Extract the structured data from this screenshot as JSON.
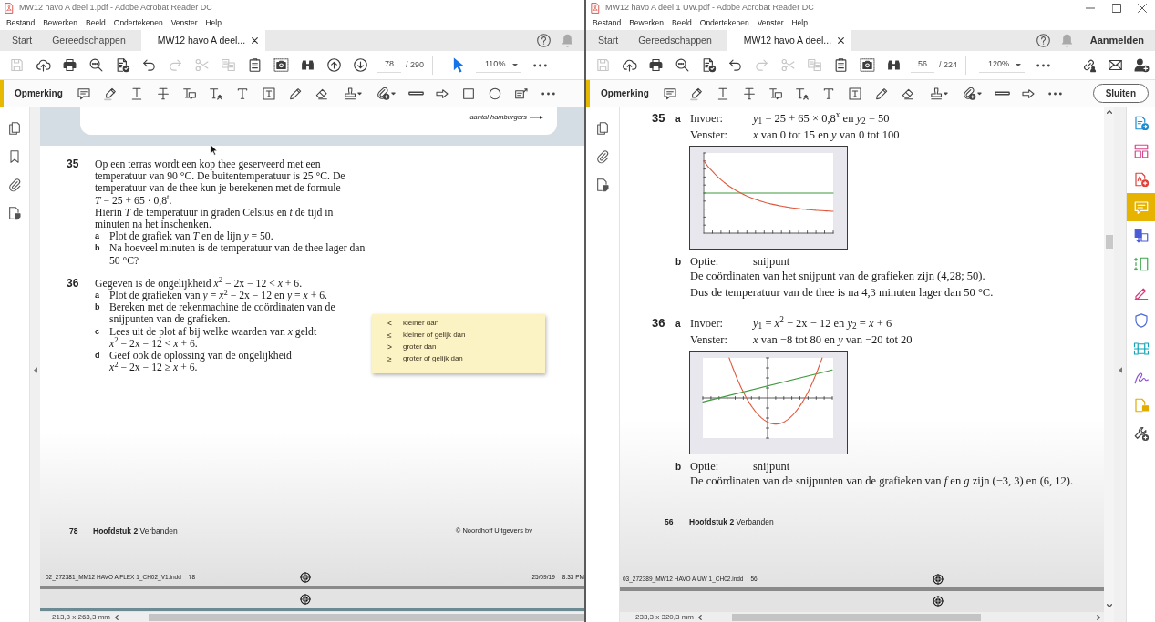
{
  "windows": [
    {
      "title": "MW12 havo A deel 1.pdf - Adobe Acrobat Reader DC",
      "menu": [
        "Bestand",
        "Bewerken",
        "Beeld",
        "Ondertekenen",
        "Venster",
        "Help"
      ],
      "tabs": [
        {
          "label": "Start",
          "selected": false
        },
        {
          "label": "Gereedschappen",
          "selected": false
        },
        {
          "label": "MW12 havo A deel...",
          "selected": true
        }
      ],
      "toolbar": [
        {
          "kind": "save",
          "disabled": true
        },
        {
          "kind": "upload",
          "disabled": false
        },
        {
          "kind": "print",
          "disabled": false
        },
        {
          "kind": "zoomsearch",
          "disabled": false
        },
        {
          "kind": "filecheck",
          "disabled": false
        },
        {
          "kind": "undo",
          "disabled": false
        },
        {
          "kind": "redo",
          "disabled": true
        },
        {
          "kind": "cut",
          "disabled": true
        },
        {
          "kind": "compare",
          "disabled": true
        },
        {
          "kind": "clipboard",
          "disabled": false
        },
        {
          "kind": "snapshot",
          "disabled": false
        },
        {
          "kind": "find",
          "disabled": false
        },
        {
          "kind": "pageup",
          "disabled": false
        },
        {
          "kind": "pagedown",
          "disabled": false
        }
      ],
      "page_field": "78",
      "page_total": "/ 290",
      "select_tool": {
        "selected": true
      },
      "zoom": "110%",
      "comment_toolbar": {
        "label": "Opmerking",
        "tools": [
          {
            "kind": "comment"
          },
          {
            "kind": "highlight"
          },
          {
            "kind": "underline"
          },
          {
            "kind": "strikethrough"
          },
          {
            "kind": "replace"
          },
          {
            "kind": "insert"
          },
          {
            "kind": "text"
          },
          {
            "kind": "textbox"
          },
          {
            "kind": "pencil"
          },
          {
            "kind": "eraser"
          },
          {
            "kind": "stamp"
          },
          {
            "kind": "attach"
          },
          {
            "kind": "line"
          },
          {
            "kind": "arrow"
          },
          {
            "kind": "rectangle"
          },
          {
            "kind": "oval"
          },
          {
            "kind": "callout"
          },
          {
            "kind": "more"
          }
        ]
      },
      "nav_panel": [
        {
          "kind": "pages"
        },
        {
          "kind": "bookmark"
        },
        {
          "kind": "attachment"
        },
        {
          "kind": "tags"
        }
      ],
      "document": {
        "kind": "exercises",
        "mouse_pointer": true,
        "figure_caption": "aantal hamburgers",
        "exercises": [
          {
            "number": "35",
            "paragraphs": [
              "Op een terras wordt een kop thee geserveerd met een temperatuur van 90 °C. De buitentemperatuur is 25 °C. De temperatuur van de thee kun je berekenen met de formule",
              "*T* = 25 + 65 · 0,8$^{t}$.",
              "Hierin *T* de temperatuur in graden Celsius en *t* de tijd in minuten na het inschenken."
            ],
            "parts": [
              {
                "label": "a",
                "text": "Plot de grafiek van *T* en de lijn *y* = 50."
              },
              {
                "label": "b",
                "text": "Na hoeveel minuten is de temperatuur van de thee lager dan 50 °C?"
              }
            ]
          },
          {
            "number": "36",
            "paragraphs": [
              "Gegeven is de ongelijkheid *x*$^{2}$ − 2x − 12 < *x* + 6."
            ],
            "parts": [
              {
                "label": "a",
                "text": "Plot de grafieken van *y* = *x*$^{2}$ − 2x − 12 en *y* = *x* + 6."
              },
              {
                "label": "b",
                "text": "Bereken met de rekenmachine de coördinaten van de snijpunten van de grafieken."
              },
              {
                "label": "c",
                "text": "Lees uit de plot af bij welke waarden van *x* geldt",
                "formula": "*x*$^{2}$ − 2x − 12 < *x* + 6."
              },
              {
                "label": "d",
                "text": "Geef ook de oplossing van de ongelijkheid",
                "formula": "*x*$^{2}$ − 2x − 12 ≥ *x* + 6."
              }
            ]
          }
        ],
        "note": [
          {
            "symbol": "<",
            "text": "kleiner dan"
          },
          {
            "symbol": "≤",
            "text": "kleiner of gelijk dan"
          },
          {
            "symbol": ">",
            "text": "groter dan"
          },
          {
            "symbol": "≥",
            "text": "groter of gelijk dan"
          }
        ],
        "footer": {
          "page": "78",
          "chapter": "**Hoofdstuk 2** Verbanden",
          "copyright": "© Noordhoff Uitgevers bv"
        },
        "slug": {
          "file": "02_272381_MM12 HAVO A FLEX 1_CH02_V1.indd",
          "page": "78",
          "date": "25/09/19",
          "time": "8:33 PM"
        }
      },
      "status": "213,3 x 263,3 mm"
    },
    {
      "title": "MW12 havo A deel 1 UW.pdf - Adobe Acrobat Reader DC",
      "window_controls": true,
      "menu": [
        "Bestand",
        "Bewerken",
        "Beeld",
        "Ondertekenen",
        "Venster",
        "Help"
      ],
      "tabs": [
        {
          "label": "Start",
          "selected": false
        },
        {
          "label": "Gereedschappen",
          "selected": false
        },
        {
          "label": "MW12 havo A deel...",
          "selected": true
        }
      ],
      "sign_in": "Aanmelden",
      "toolbar": [
        {
          "kind": "save",
          "disabled": true
        },
        {
          "kind": "upload",
          "disabled": false
        },
        {
          "kind": "print",
          "disabled": false
        },
        {
          "kind": "zoomsearch",
          "disabled": false
        },
        {
          "kind": "filecheck",
          "disabled": false
        },
        {
          "kind": "undo",
          "disabled": false
        },
        {
          "kind": "redo",
          "disabled": true
        },
        {
          "kind": "cut",
          "disabled": true
        },
        {
          "kind": "compare",
          "disabled": true
        },
        {
          "kind": "clipboard",
          "disabled": false
        },
        {
          "kind": "snapshot",
          "disabled": false
        },
        {
          "kind": "find",
          "disabled": false
        }
      ],
      "page_field": "56",
      "page_total": "/ 224",
      "zoom": "120%",
      "share_tools": [
        {
          "kind": "link"
        },
        {
          "kind": "mail"
        },
        {
          "kind": "adduser"
        }
      ],
      "comment_toolbar": {
        "label": "Opmerking",
        "tools": [
          {
            "kind": "comment"
          },
          {
            "kind": "highlight"
          },
          {
            "kind": "underline"
          },
          {
            "kind": "strikethrough"
          },
          {
            "kind": "replace"
          },
          {
            "kind": "insert"
          },
          {
            "kind": "text"
          },
          {
            "kind": "textbox"
          },
          {
            "kind": "pencil"
          },
          {
            "kind": "eraser"
          },
          {
            "kind": "stamp"
          },
          {
            "kind": "attach"
          },
          {
            "kind": "line"
          },
          {
            "kind": "arrow"
          },
          {
            "kind": "more"
          }
        ],
        "close_button": "Sluiten"
      },
      "nav_panel": [
        {
          "kind": "pages"
        },
        {
          "kind": "attachment"
        },
        {
          "kind": "tags"
        }
      ],
      "tools_panel": [
        {
          "kind": "export",
          "selected": false
        },
        {
          "kind": "organize",
          "selected": false
        },
        {
          "kind": "create",
          "selected": false
        },
        {
          "kind": "comment",
          "selected": true
        },
        {
          "kind": "combine",
          "selected": false
        },
        {
          "kind": "edit",
          "selected": false
        },
        {
          "kind": "fill",
          "selected": false
        },
        {
          "kind": "protect",
          "selected": false
        },
        {
          "kind": "scan",
          "selected": false
        },
        {
          "kind": "sign",
          "selected": false
        },
        {
          "kind": "send",
          "selected": false
        },
        {
          "kind": "tools",
          "selected": false
        }
      ],
      "document": {
        "kind": "answers",
        "answers": [
          {
            "number": "35",
            "parts": [
              {
                "label": "a",
                "rows": [
                  {
                    "key": "Invoer:",
                    "value": "*y*$_{1}$ = 25 + 65 × 0,8$^{x}$ en *y*$_{2}$ = 50"
                  },
                  {
                    "key": "Venster:",
                    "value": "*x* van 0 tot 15 en *y* van 0 tot 100"
                  }
                ],
                "graph": {
                  "kind": "exponential"
                }
              },
              {
                "label": "b",
                "rows": [
                  {
                    "key": "Optie:",
                    "value": "snijpunt"
                  }
                ],
                "lines": [
                  "De coördinaten van het snijpunt van de grafieken zijn (4,28; 50).",
                  "Dus de temperatuur van de thee is na 4,3 minuten lager dan 50 °C."
                ]
              }
            ]
          },
          {
            "number": "36",
            "parts": [
              {
                "label": "a",
                "rows": [
                  {
                    "key": "Invoer:",
                    "value": "*y*$_{1}$ = *x*$^{2}$ − 2x − 12 en *y*$_{2}$ = *x* + 6"
                  },
                  {
                    "key": "Venster:",
                    "value": "*x* van −8 tot 80 en *y* van −20 tot 20"
                  }
                ],
                "graph": {
                  "kind": "parabola"
                }
              },
              {
                "label": "b",
                "rows": [
                  {
                    "key": "Optie:",
                    "value": "snijpunt"
                  }
                ],
                "lines": [
                  "De coördinaten van de snijpunten van de grafieken van *f* en *g* zijn (−3, 3) en (6, 12)."
                ]
              }
            ]
          }
        ],
        "footer": {
          "page": "56",
          "chapter": "**Hoofdstuk 2** Verbanden"
        },
        "slug": {
          "file": "03_272389_MW12 HAVO A UW 1_CH02.indd",
          "page": "56"
        }
      },
      "status": "233,3 x 320,3 mm"
    }
  ]
}
